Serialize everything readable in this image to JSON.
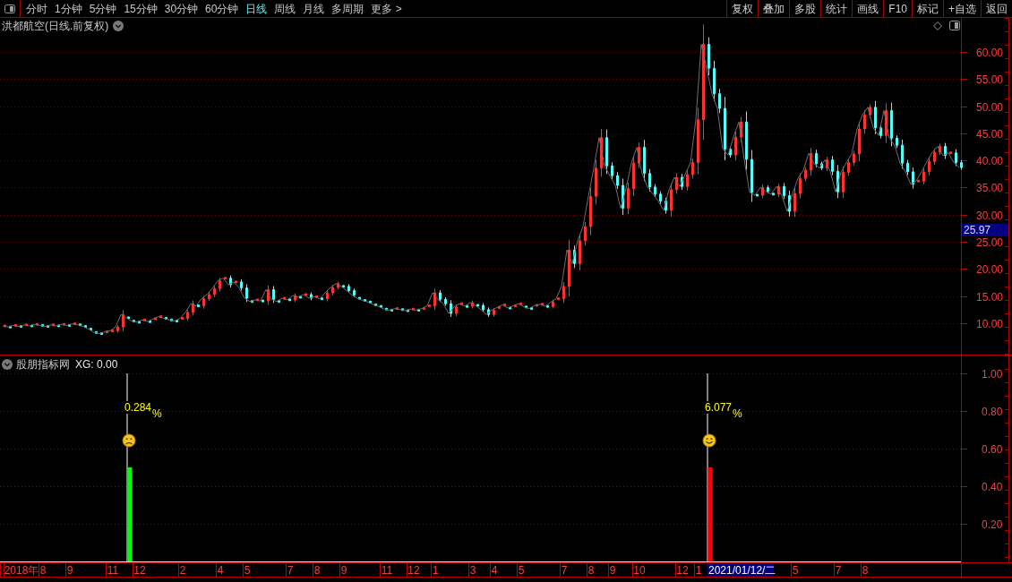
{
  "toolbar": {
    "tabs": [
      {
        "label": "分时",
        "selected": false
      },
      {
        "label": "1分钟",
        "selected": false
      },
      {
        "label": "5分钟",
        "selected": false
      },
      {
        "label": "15分钟",
        "selected": false
      },
      {
        "label": "30分钟",
        "selected": false
      },
      {
        "label": "60分钟",
        "selected": false
      },
      {
        "label": "日线",
        "selected": true
      },
      {
        "label": "周线",
        "selected": false
      },
      {
        "label": "月线",
        "selected": false
      },
      {
        "label": "多周期",
        "selected": false
      },
      {
        "label": "更多 >",
        "selected": false
      }
    ],
    "buttons": [
      "复权",
      "叠加",
      "多股",
      "统计",
      "画线",
      "F10",
      "标记",
      "+自选",
      "返回"
    ]
  },
  "price_chart": {
    "chart_data": {
      "type": "line",
      "title": "洪都航空(日线.前复权)",
      "grid": true,
      "ylim": [
        4.22,
        66.27
      ],
      "yticks": [
        {
          "value": 60,
          "label": "60.00"
        },
        {
          "value": 55,
          "label": "55.00"
        },
        {
          "value": 50,
          "label": "50.00"
        },
        {
          "value": 45,
          "label": "45.00"
        },
        {
          "value": 40,
          "label": "40.00"
        },
        {
          "value": 35,
          "label": "35.00"
        },
        {
          "value": 30,
          "label": "30.00"
        },
        {
          "value": 25,
          "label": "25.00"
        },
        {
          "value": 20,
          "label": "20.00"
        },
        {
          "value": 15,
          "label": "15.00"
        },
        {
          "value": 10,
          "label": "10.00"
        }
      ],
      "series": [
        {
          "values": [
            9.5,
            9.3,
            9.6,
            9.4,
            9.7,
            9.5,
            9.8,
            9.6,
            9.4,
            9.7,
            9.5,
            9.8,
            9.6,
            9.9,
            9.7,
            9.4,
            8.9,
            8.3,
            8.1,
            8.4,
            8.6,
            9.3,
            11.6,
            11.0,
            10.4,
            10.2,
            10.6,
            10.3,
            10.8,
            11.2,
            10.9,
            10.6,
            10.4,
            10.9,
            12.0,
            13.6,
            13.2,
            14.5,
            15.3,
            16.4,
            17.8,
            18.3,
            17.1,
            17.6,
            16.5,
            14.6,
            14.0,
            14.3,
            14.1,
            16.2,
            14.4,
            14.0,
            14.6,
            14.3,
            15.1,
            14.8,
            15.3,
            14.6,
            14.9,
            14.5,
            15.6,
            16.6,
            17.3,
            16.8,
            16.0,
            15.2,
            14.6,
            14.2,
            13.9,
            13.4,
            13.1,
            12.6,
            12.4,
            12.7,
            12.5,
            12.3,
            12.6,
            12.4,
            12.7,
            13.2,
            15.6,
            14.4,
            13.6,
            11.8,
            13.0,
            13.6,
            13.1,
            13.8,
            13.3,
            12.5,
            11.6,
            12.4,
            12.9,
            13.4,
            12.8,
            13.2,
            13.6,
            13.0,
            12.7,
            13.3,
            13.5,
            13.1,
            13.9,
            14.5,
            16.8,
            23.5,
            21.0,
            25.2,
            27.8,
            33.4,
            38.6,
            44.2,
            39.0,
            37.2,
            35.4,
            31.2,
            34.8,
            39.5,
            42.4,
            37.6,
            35.1,
            33.8,
            32.5,
            30.8,
            34.6,
            36.9,
            35.2,
            37.4,
            39.6,
            47.5,
            61.4,
            57.0,
            52.3,
            49.6,
            42.1,
            41.0,
            44.3,
            47.1,
            40.2,
            34.1,
            33.6,
            35.0,
            34.3,
            33.8,
            35.2,
            33.5,
            30.6,
            33.9,
            36.7,
            38.2,
            41.3,
            39.4,
            38.6,
            40.1,
            38.0,
            34.2,
            37.8,
            39.6,
            41.2,
            45.8,
            48.4,
            49.8,
            46.0,
            44.6,
            49.2,
            44.1,
            42.8,
            39.5,
            37.9,
            35.6,
            36.2,
            37.9,
            39.8,
            41.5,
            42.6,
            40.9,
            41.4,
            39.6,
            38.7
          ]
        }
      ],
      "annotations": [
        "25.97"
      ]
    }
  },
  "indicator": {
    "name": "股朋指标网",
    "reading": "XG: 0.00",
    "signals": [
      {
        "kind": "sad",
        "text": "0.284",
        "unit": "%"
      },
      {
        "kind": "happy",
        "text": "6.077",
        "unit": "%",
        "cursor_date": "2021/01/12/二"
      }
    ],
    "chart_data": {
      "type": "bar",
      "grid": true,
      "ylim": [
        0,
        1.095
      ],
      "yticks": [
        {
          "value": 1,
          "label": "1.00"
        },
        {
          "value": 0.8,
          "label": "0.80"
        },
        {
          "value": 0.6,
          "label": "0.60"
        },
        {
          "value": 0.4,
          "label": "0.40"
        },
        {
          "value": 0.2,
          "label": "0.20"
        }
      ],
      "categories": [
        null,
        null,
        null,
        "2018年",
        null,
        null,
        null,
        "8",
        null,
        null,
        null,
        null,
        "9",
        null,
        null,
        null,
        null,
        null,
        null,
        null,
        "11",
        null,
        null,
        null,
        null,
        "12",
        null,
        null,
        null,
        null,
        null,
        null,
        null,
        "2",
        null,
        null,
        null,
        null,
        null,
        null,
        "4",
        null,
        null,
        null,
        null,
        "5",
        null,
        null,
        null,
        null,
        null,
        null,
        null,
        "7",
        null,
        null,
        null,
        null,
        "8",
        null,
        null,
        null,
        null,
        "9",
        null,
        null,
        null,
        null,
        null,
        null,
        null,
        "11",
        null,
        null,
        null,
        null,
        "12",
        null,
        null,
        null,
        "1",
        null,
        null,
        null,
        null,
        null,
        null,
        "3",
        null,
        null,
        null,
        "4",
        null,
        null,
        null,
        null,
        "5",
        null,
        null,
        null,
        null,
        null,
        null,
        null,
        "7",
        null,
        null,
        null,
        null,
        "8",
        null,
        null,
        null,
        "9",
        null,
        null,
        null,
        null,
        "10",
        null,
        null,
        null,
        null,
        null,
        null,
        null,
        "12",
        null,
        null,
        "1",
        null,
        null,
        null,
        null,
        null,
        null,
        null,
        null,
        null,
        null,
        null,
        null,
        null,
        null,
        null,
        null,
        null,
        "5",
        null,
        null,
        null,
        null,
        null,
        null,
        null,
        "7",
        null,
        null,
        null,
        null,
        "8",
        null,
        null,
        null,
        null,
        null,
        null,
        null,
        null,
        null,
        null,
        null,
        null,
        null,
        null,
        null,
        null,
        null,
        null
      ],
      "series": [
        {
          "color": "#ffffff",
          "values": [
            0,
            0,
            0,
            0,
            0,
            0,
            0,
            0,
            0,
            0,
            0,
            0,
            0,
            0,
            0,
            0,
            0,
            0,
            0,
            0,
            0,
            0,
            0,
            1,
            0,
            0,
            0,
            0,
            0,
            0,
            0,
            0,
            0,
            0,
            0,
            0,
            0,
            0,
            0,
            0,
            0,
            0,
            0,
            0,
            0,
            0,
            0,
            0,
            0,
            0,
            0,
            0,
            0,
            0,
            0,
            0,
            0,
            0,
            0,
            0,
            0,
            0,
            0,
            0,
            0,
            0,
            0,
            0,
            0,
            0,
            0,
            0,
            0,
            0,
            0,
            0,
            0,
            0,
            0,
            0,
            0,
            0,
            0,
            0,
            0,
            0,
            0,
            0,
            0,
            0,
            0,
            0,
            0,
            0,
            0,
            0,
            0,
            0,
            0,
            0,
            0,
            0,
            0,
            0,
            0,
            0,
            0,
            0,
            0,
            0,
            0,
            0,
            0,
            0,
            0,
            0,
            0,
            0,
            0,
            0,
            0,
            0,
            0,
            0,
            0,
            0,
            0,
            0,
            0,
            0,
            0,
            1,
            0,
            0,
            0,
            0,
            0,
            0,
            0,
            0,
            0,
            0,
            0,
            0,
            0,
            0,
            0,
            0,
            0,
            0,
            0,
            0,
            0,
            0,
            0,
            0,
            0,
            0,
            0,
            0,
            0,
            0,
            0,
            0,
            0,
            0,
            0,
            0,
            0,
            0,
            0,
            0,
            0,
            0,
            0,
            0,
            0,
            0,
            0
          ]
        },
        {
          "color": "#00ff00",
          "values": [
            0,
            0,
            0,
            0,
            0,
            0,
            0,
            0,
            0,
            0,
            0,
            0,
            0,
            0,
            0,
            0,
            0,
            0,
            0,
            0,
            0,
            0,
            0,
            0.5,
            0,
            0,
            0,
            0,
            0,
            0,
            0,
            0,
            0,
            0,
            0,
            0,
            0,
            0,
            0,
            0,
            0,
            0,
            0,
            0,
            0,
            0,
            0,
            0,
            0,
            0,
            0,
            0,
            0,
            0,
            0,
            0,
            0,
            0,
            0,
            0,
            0,
            0,
            0,
            0,
            0,
            0,
            0,
            0,
            0,
            0,
            0,
            0,
            0,
            0,
            0,
            0,
            0,
            0,
            0,
            0,
            0,
            0,
            0,
            0,
            0,
            0,
            0,
            0,
            0,
            0,
            0,
            0,
            0,
            0,
            0,
            0,
            0,
            0,
            0,
            0,
            0,
            0,
            0,
            0,
            0,
            0,
            0,
            0,
            0,
            0,
            0,
            0,
            0,
            0,
            0,
            0,
            0,
            0,
            0,
            0,
            0,
            0,
            0,
            0,
            0,
            0,
            0,
            0,
            0,
            0,
            0,
            0,
            0,
            0,
            0,
            0,
            0,
            0,
            0,
            0,
            0,
            0,
            0,
            0,
            0,
            0,
            0,
            0,
            0,
            0,
            0,
            0,
            0,
            0,
            0,
            0,
            0,
            0,
            0,
            0,
            0,
            0,
            0,
            0,
            0,
            0,
            0,
            0,
            0,
            0,
            0,
            0,
            0,
            0,
            0,
            0,
            0,
            0,
            0
          ]
        },
        {
          "color": "#ff0000",
          "values": [
            0,
            0,
            0,
            0,
            0,
            0,
            0,
            0,
            0,
            0,
            0,
            0,
            0,
            0,
            0,
            0,
            0,
            0,
            0,
            0,
            0,
            0,
            0,
            0,
            0,
            0,
            0,
            0,
            0,
            0,
            0,
            0,
            0,
            0,
            0,
            0,
            0,
            0,
            0,
            0,
            0,
            0,
            0,
            0,
            0,
            0,
            0,
            0,
            0,
            0,
            0,
            0,
            0,
            0,
            0,
            0,
            0,
            0,
            0,
            0,
            0,
            0,
            0,
            0,
            0,
            0,
            0,
            0,
            0,
            0,
            0,
            0,
            0,
            0,
            0,
            0,
            0,
            0,
            0,
            0,
            0,
            0,
            0,
            0,
            0,
            0,
            0,
            0,
            0,
            0,
            0,
            0,
            0,
            0,
            0,
            0,
            0,
            0,
            0,
            0,
            0,
            0,
            0,
            0,
            0,
            0,
            0,
            0,
            0,
            0,
            0,
            0,
            0,
            0,
            0,
            0,
            0,
            0,
            0,
            0,
            0,
            0,
            0,
            0,
            0,
            0,
            0,
            0,
            0,
            0,
            0,
            0.5,
            0,
            0,
            0,
            0,
            0,
            0,
            0,
            0,
            0,
            0,
            0,
            0,
            0,
            0,
            0,
            0,
            0,
            0,
            0,
            0,
            0,
            0,
            0,
            0,
            0,
            0,
            0,
            0,
            0,
            0,
            0,
            0,
            0,
            0,
            0,
            0,
            0,
            0,
            0,
            0,
            0,
            0,
            0,
            0,
            0,
            0,
            0
          ]
        }
      ]
    }
  }
}
